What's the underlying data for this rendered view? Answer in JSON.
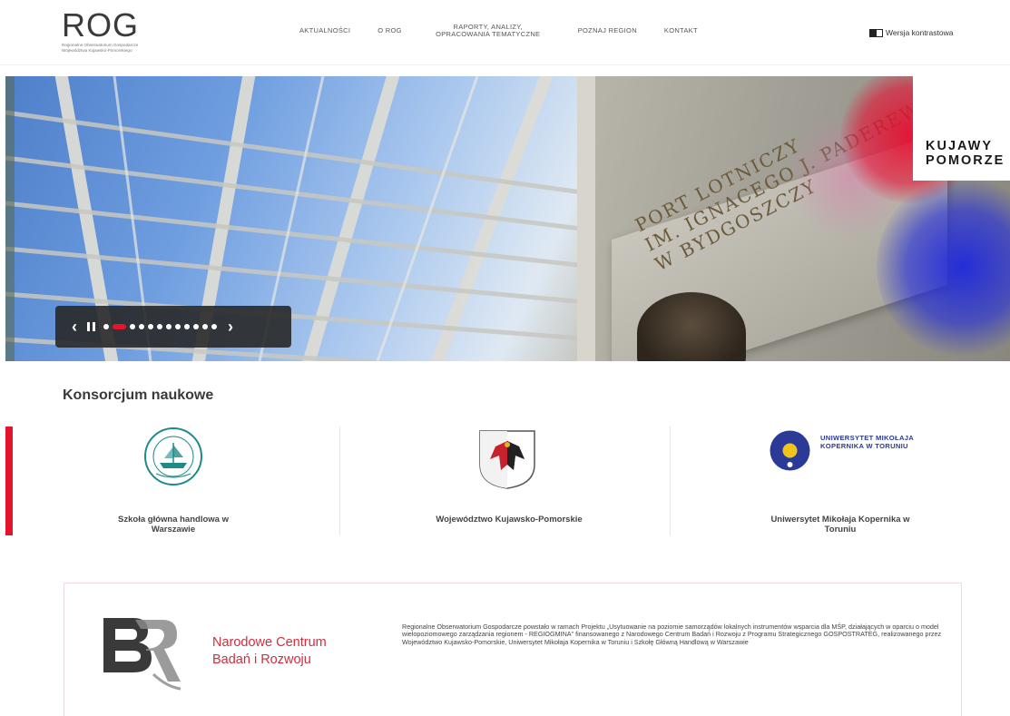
{
  "header": {
    "logo_mark": "ROG",
    "logo_subtitle": "Regionalne Obserwatorium Gospodarcze Województwa Kujawsko-Pomorskiego",
    "nav": [
      {
        "label": "AKTUALNOŚCI"
      },
      {
        "label": "O ROG"
      },
      {
        "label": "RAPORTY, ANALIZY, OPRACOWANIA TEMATYCZNE"
      },
      {
        "label": "POZNAJ REGION"
      },
      {
        "label": "KONTAKT"
      }
    ],
    "contrast_label": "Wersja kontrastowa"
  },
  "hero": {
    "plaque_text_1": "PORT LOTNICZY",
    "plaque_text_2": "IM. IGNACEGO J. PADEREWSKIEGO",
    "plaque_text_3": "W BYDGOSZCZY",
    "badge_line1": "KUJAWY",
    "badge_line2": "POMORZE",
    "colors": {
      "red": "#e3152c",
      "blue": "#1e28dc"
    }
  },
  "slider": {
    "prev_glyph": "‹",
    "next_glyph": "›",
    "dot_count": 12,
    "active_index": 1
  },
  "consortium": {
    "title": "Konsorcjum naukowe",
    "partners": [
      {
        "name": "Szkoła główna handlowa w Warszawie",
        "logo": "sgh-seal-icon"
      },
      {
        "name": "Województwo Kujawsko-Pomorskie",
        "logo": "coat-of-arms-icon"
      },
      {
        "name": "Uniwersytet Mikołaja Kopernika w Toruniu",
        "logo": "umk-logo-icon",
        "logo_text": "UNIWERSYTET MIKOŁAJA KOPERNIKA W TORUNIU"
      }
    ],
    "accent": "#e3152c"
  },
  "ncbr": {
    "name_line1": "Narodowe Centrum",
    "name_line2": "Badań i Rozwoju",
    "description": "Regionalne Obserwatorium Gospodarcze powstało w ramach Projektu „Usytuowanie na poziomie samorządów lokalnych instrumentów wsparcia dla MŚP, działających w oparciu o model wielopoziomowego zarządzania regionem - REGIOGMINA\" finansowanego z Narodowego Centrum Badań i Rozwoju z Programu Strategicznego GOSPOSTRATEG, realizowanego przez Województwo Kujawsko-Pomorskie, Uniwersytet Mikołaja Kopernika w Toruniu i Szkołę Główną Handlową w Warszawie"
  }
}
